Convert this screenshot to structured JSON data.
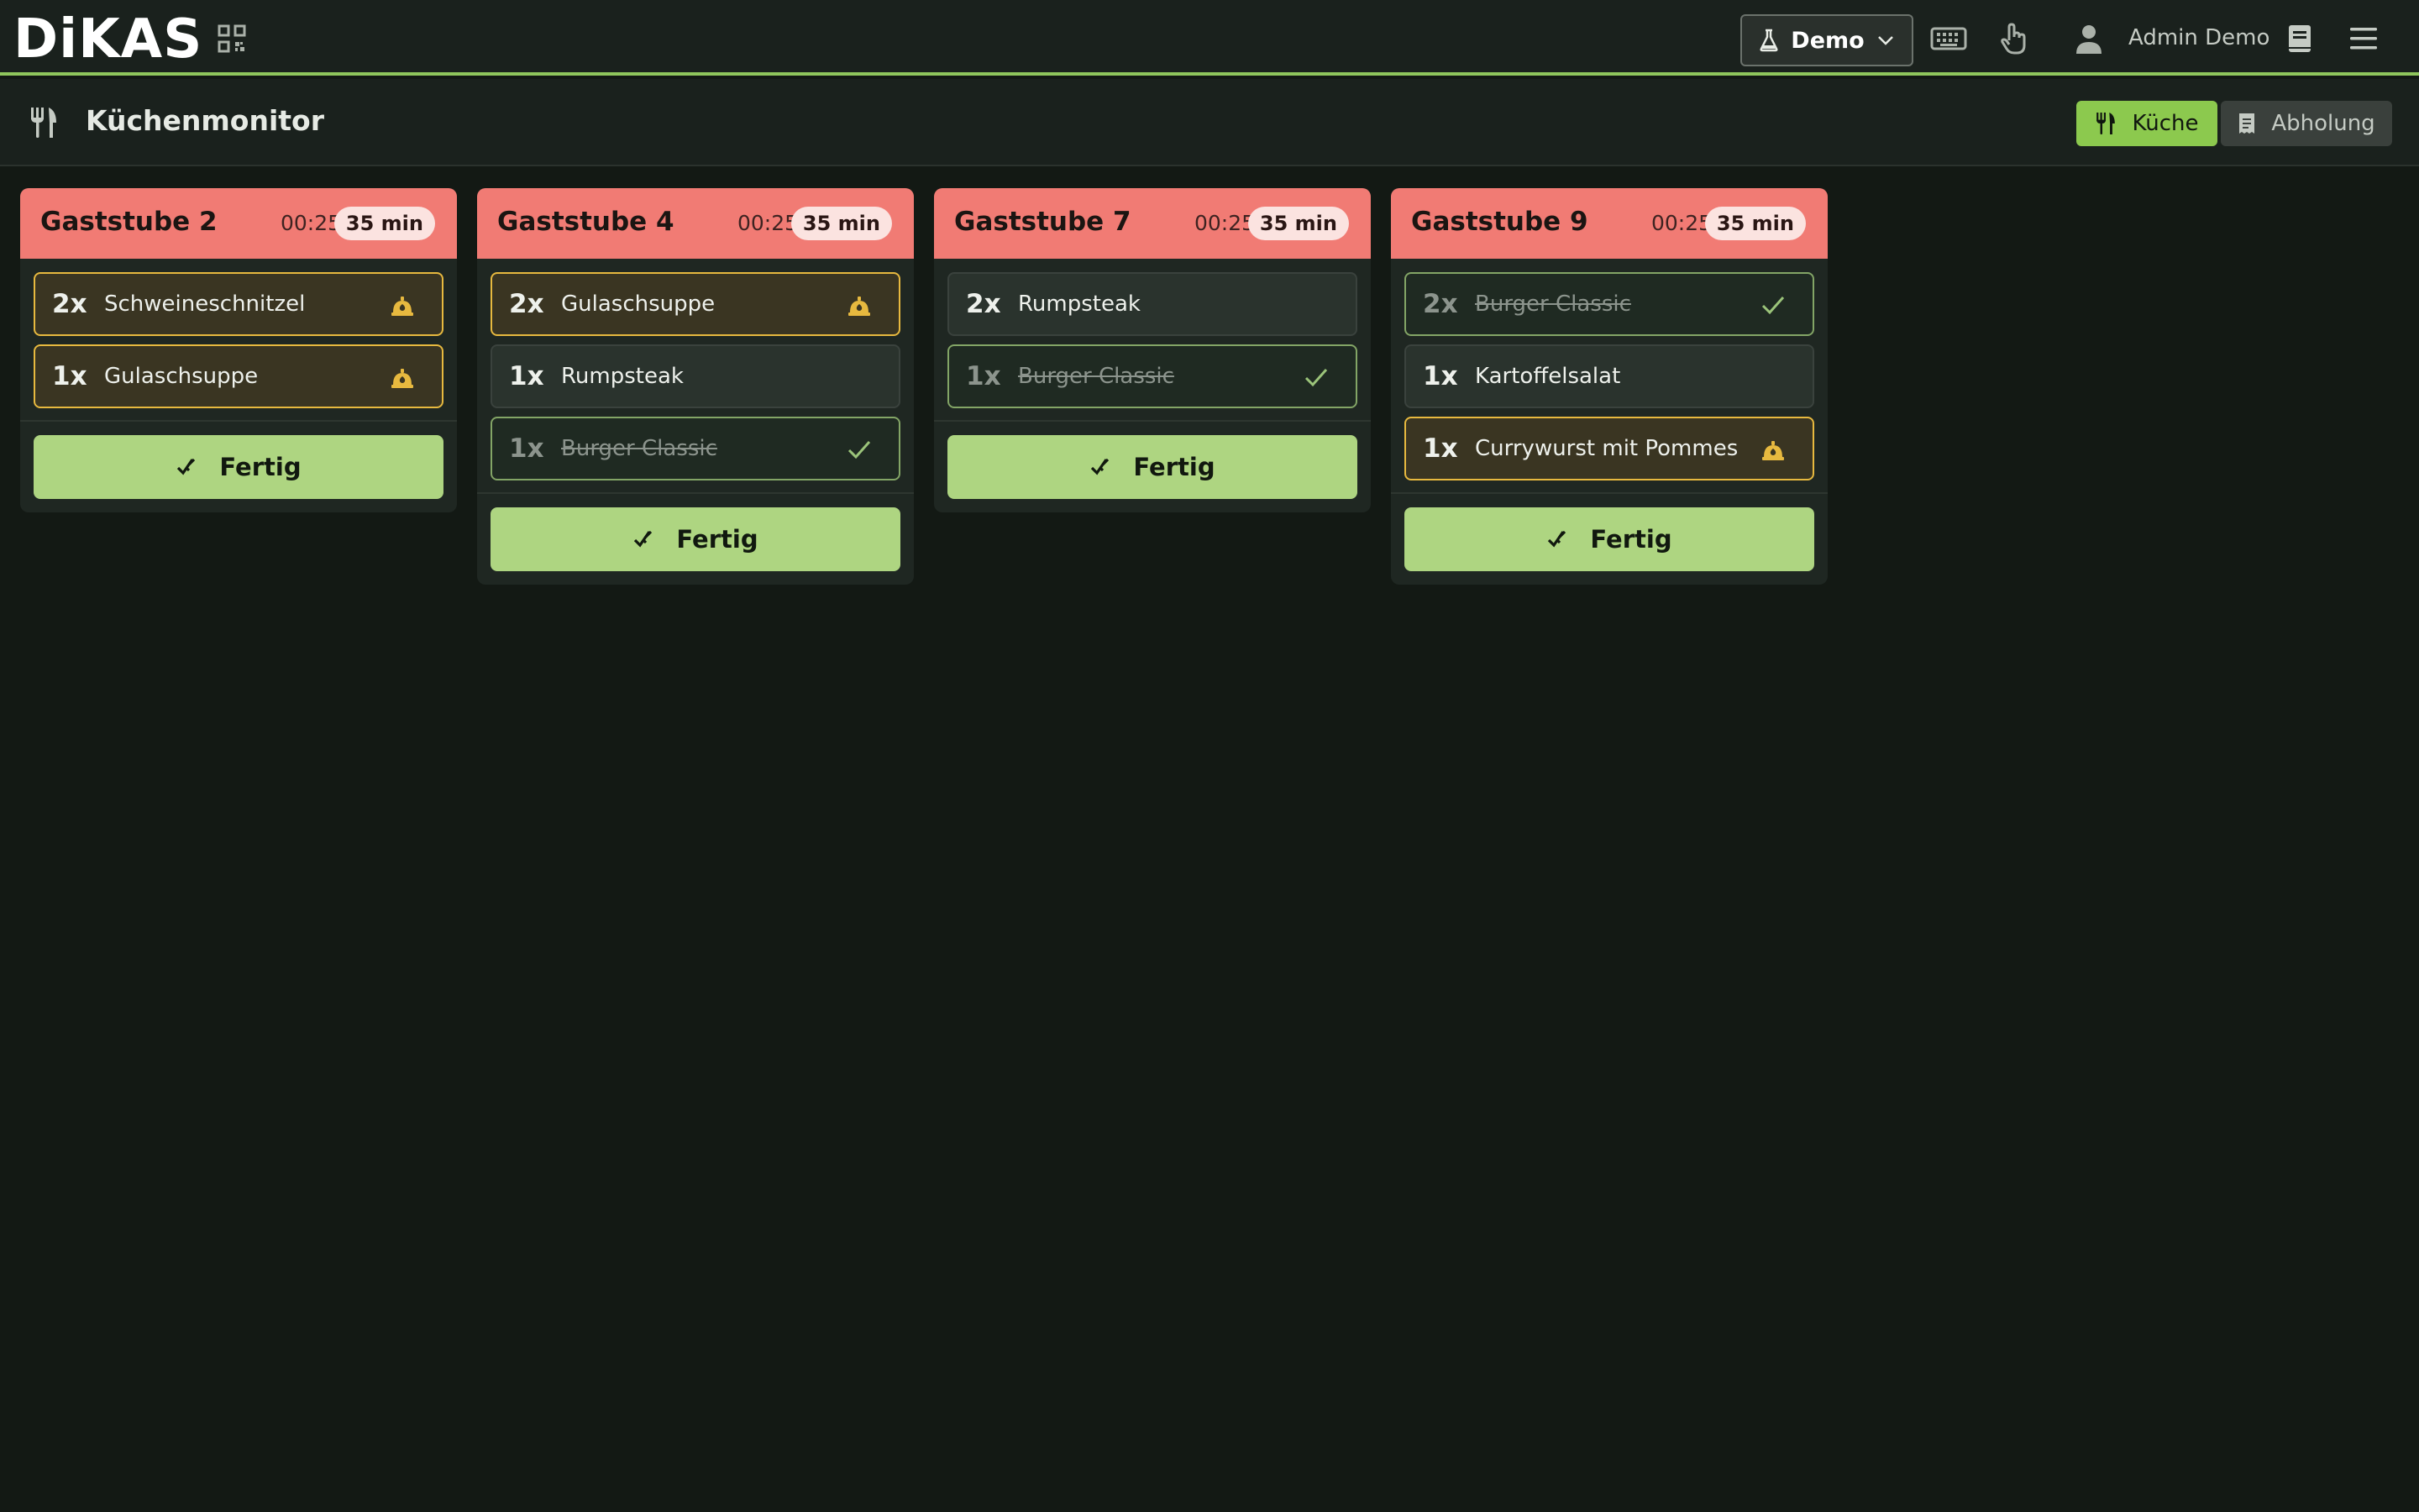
{
  "app": {
    "logo": "DiKAS",
    "environment": "Demo",
    "user": "Admin Demo"
  },
  "page": {
    "title": "Küchenmonitor",
    "tabs": [
      {
        "label": "Küche",
        "active": true
      },
      {
        "label": "Abholung",
        "active": false
      }
    ]
  },
  "colors": {
    "accent": "#8cc94e",
    "card_header": "#f17b74",
    "cooking": "#e7b93f",
    "done": "#83a566"
  },
  "orders": [
    {
      "table": "Gaststube 2",
      "time": "00:25",
      "elapsed": "35 min",
      "items": [
        {
          "qty": "2x",
          "name": "Schweineschnitzel",
          "status": "cooking"
        },
        {
          "qty": "1x",
          "name": "Gulaschsuppe",
          "status": "cooking"
        }
      ],
      "action": "Fertig"
    },
    {
      "table": "Gaststube 4",
      "time": "00:25",
      "elapsed": "35 min",
      "items": [
        {
          "qty": "2x",
          "name": "Gulaschsuppe",
          "status": "cooking"
        },
        {
          "qty": "1x",
          "name": "Rumpsteak",
          "status": "open"
        },
        {
          "qty": "1x",
          "name": "Burger Classic",
          "status": "done"
        }
      ],
      "action": "Fertig"
    },
    {
      "table": "Gaststube 7",
      "time": "00:25",
      "elapsed": "35 min",
      "items": [
        {
          "qty": "2x",
          "name": "Rumpsteak",
          "status": "open"
        },
        {
          "qty": "1x",
          "name": "Burger Classic",
          "status": "done"
        }
      ],
      "action": "Fertig"
    },
    {
      "table": "Gaststube 9",
      "time": "00:25",
      "elapsed": "35 min",
      "items": [
        {
          "qty": "2x",
          "name": "Burger Classic",
          "status": "done"
        },
        {
          "qty": "1x",
          "name": "Kartoffelsalat",
          "status": "open"
        },
        {
          "qty": "1x",
          "name": "Currywurst mit Pommes",
          "status": "cooking"
        }
      ],
      "action": "Fertig"
    }
  ]
}
